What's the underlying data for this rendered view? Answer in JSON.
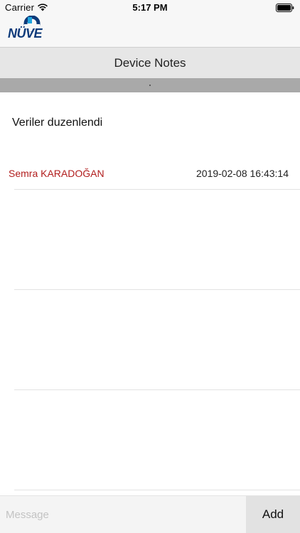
{
  "status_bar": {
    "carrier": "Carrier",
    "time": "5:17 PM",
    "wifi_icon": "wifi-icon",
    "battery_icon": "battery-icon"
  },
  "logo": {
    "text": "NÜVE",
    "color": "#0d3a7a"
  },
  "header": {
    "title": "Device Notes"
  },
  "note": {
    "text": "Veriler duzenlendi",
    "author": "Semra KARADOĞAN",
    "date": "2019-02-08 16:43:14",
    "author_color": "#b11d1d"
  },
  "composer": {
    "placeholder": "Message",
    "add_label": "Add"
  }
}
